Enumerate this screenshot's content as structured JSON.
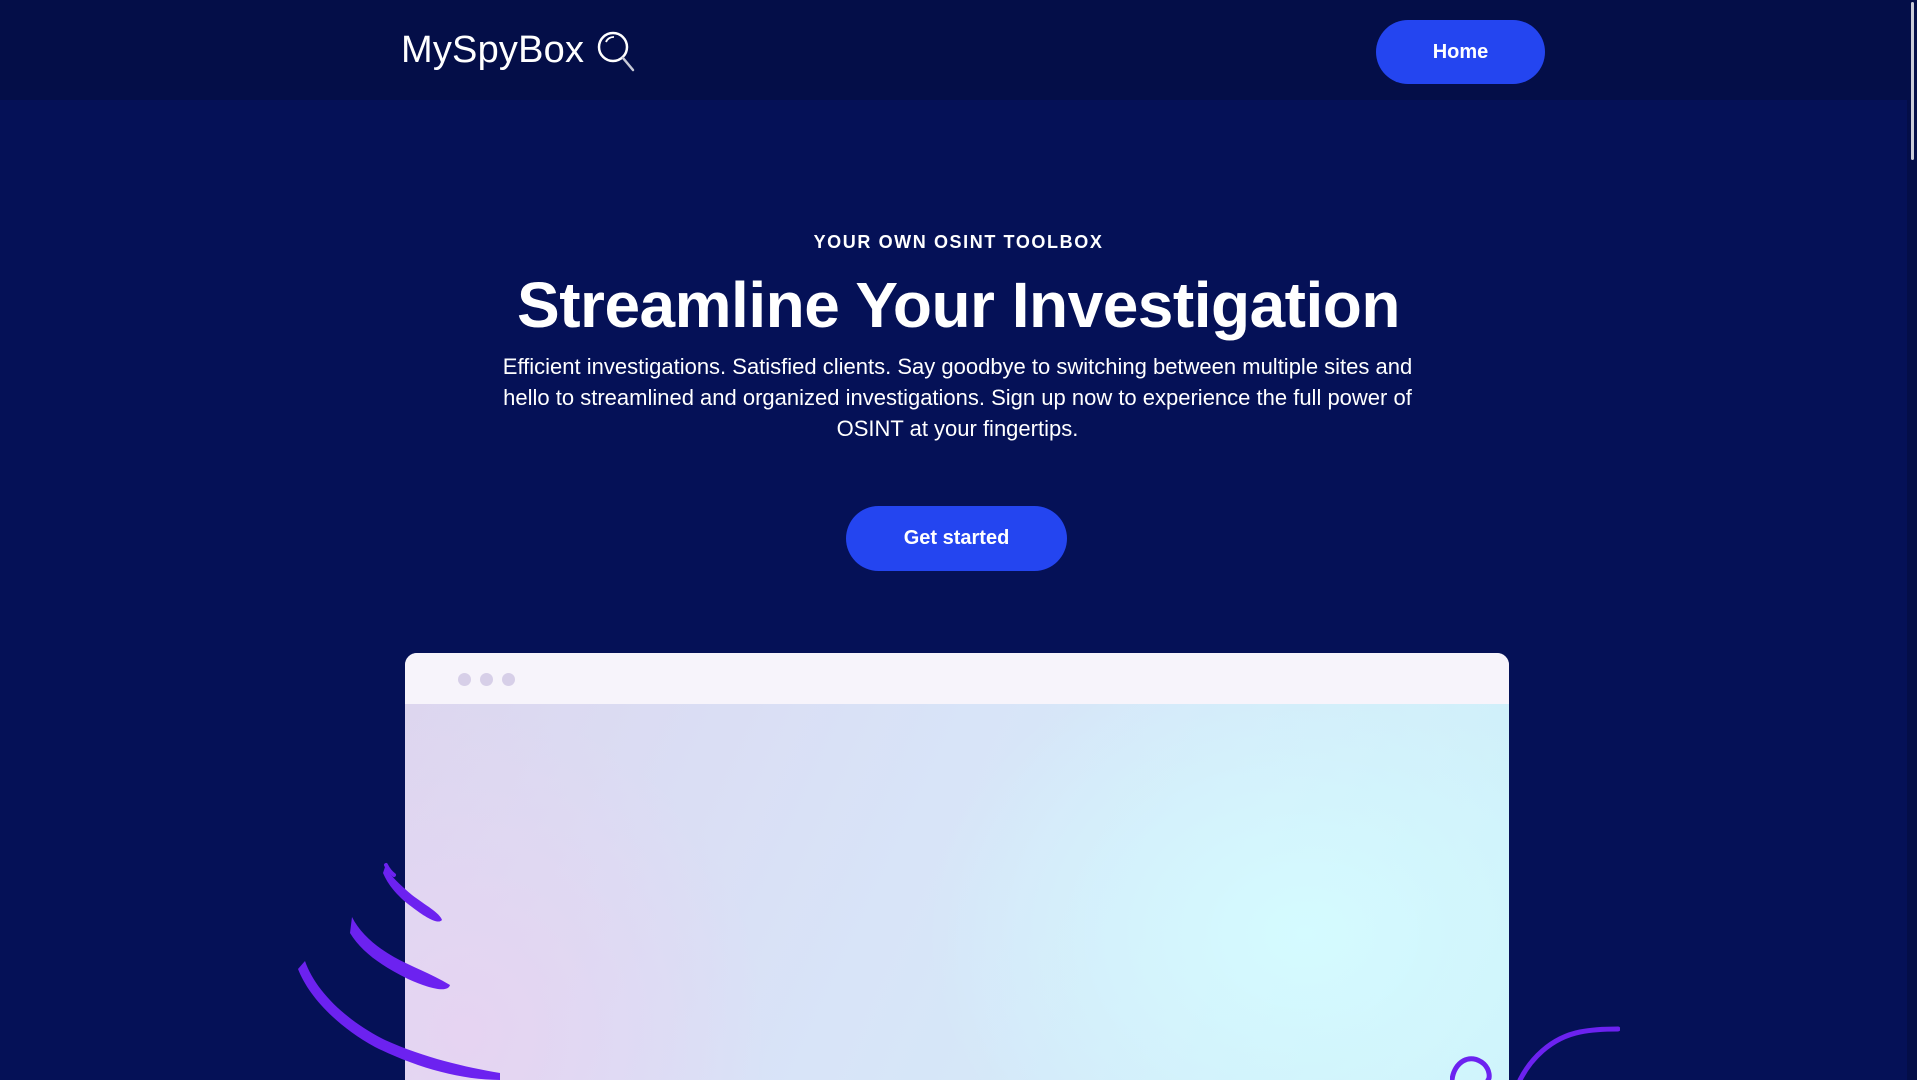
{
  "header": {
    "brand": "MySpyBox",
    "brand_icon": "magnifier-icon",
    "home_label": "Home"
  },
  "hero": {
    "eyebrow": "YOUR OWN OSINT TOOLBOX",
    "headline": "Streamline Your Investigation",
    "subtext": "Efficient investigations. Satisfied clients. Say goodbye to switching between multiple sites and hello to streamlined and organized investigations. Sign up now to experience the full power of OSINT at your fingertips.",
    "cta_label": "Get started"
  },
  "colors": {
    "page_background": "#051157",
    "header_background": "#040e48",
    "button_blue": "#2445f0",
    "decor_purple": "#6c22f0"
  }
}
